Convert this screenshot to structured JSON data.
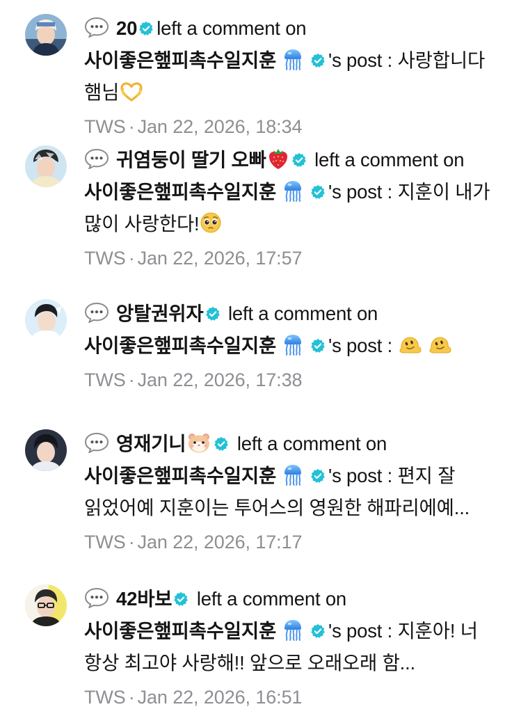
{
  "notifications": [
    {
      "user": "20",
      "user_emoji": "",
      "action": "left a comment on",
      "target": "사이좋은햎피촉수일지훈",
      "target_emoji": "jellyfish-icon",
      "suffix": "'s post : ",
      "comment": "사랑합니다 햄님",
      "comment_emoji": "heart-hands-icon",
      "source": "TWS",
      "time": "Jan 22, 2026, 18:34"
    },
    {
      "user": "귀염둥이 딸기 오빠",
      "user_emoji": "strawberry-icon",
      "action": "left a comment on",
      "target": "사이좋은햎피촉수일지훈",
      "target_emoji": "jellyfish-icon",
      "suffix": "'s post : ",
      "comment": "지훈이 내가 많이 사랑한다!",
      "comment_emoji": "pleading-face-icon",
      "source": "TWS",
      "time": "Jan 22, 2026, 17:57"
    },
    {
      "user": "앙탈권위자",
      "user_emoji": "",
      "action": "left a comment on",
      "target": "사이좋은햎피촉수일지훈",
      "target_emoji": "jellyfish-icon",
      "suffix": "'s post : ",
      "comment": "",
      "comment_emoji": "melting-face-icon",
      "source": "TWS",
      "time": "Jan 22, 2026, 17:38"
    },
    {
      "user": "영재기니",
      "user_emoji": "hamster-icon",
      "action": "left a comment on",
      "target": "사이좋은햎피촉수일지훈",
      "target_emoji": "jellyfish-icon",
      "suffix": "'s post : ",
      "comment": "편지 잘 읽었어예 지훈이는 투어스의 영원한 해파리에예...",
      "comment_emoji": "",
      "source": "TWS",
      "time": "Jan 22, 2026, 17:17"
    },
    {
      "user": "42바보",
      "user_emoji": "",
      "action": "left a comment on",
      "target": "사이좋은햎피촉수일지훈",
      "target_emoji": "jellyfish-icon",
      "suffix": "'s post : ",
      "comment": "지훈아! 너 항상 최고야 사랑해!! 앞으로 오래오래 함...",
      "comment_emoji": "",
      "source": "TWS",
      "time": "Jan 22, 2026, 16:51"
    }
  ],
  "colors": {
    "verified": "#22c1d6",
    "meta_text": "#8e8e93",
    "body_text": "#141414"
  }
}
